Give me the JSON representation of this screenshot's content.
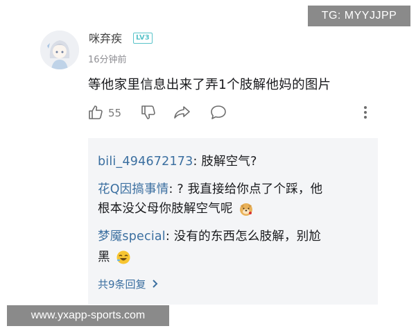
{
  "watermark_top": "TG: MYYJJPP",
  "watermark_bottom": "www.yxapp-sports.com",
  "comment": {
    "username": "咪弃疾",
    "level": "LV3",
    "time": "16分钟前",
    "text": "等他家里信息出来了弄1个肢解他妈的图片",
    "like_count": "55"
  },
  "replies": [
    {
      "name": "bili_494672173",
      "sep": ": ",
      "text": "肢解空气?"
    },
    {
      "name": "花Q因搞事情",
      "sep": ": ",
      "text": "? 我直接给你点了个踩，他",
      "text2": "根本没父母你肢解空气呢",
      "emoji": "doge-emoji"
    },
    {
      "name": "梦魇special",
      "sep": ": ",
      "text": "没有的东西怎么肢解，别尬",
      "text2": "黑",
      "emoji": "laugh-emoji"
    }
  ],
  "more_replies": "共9条回复",
  "colors": {
    "accent": "#3b6fa0",
    "level": "#58c3c9",
    "reply_bg": "#f4f5f7"
  }
}
